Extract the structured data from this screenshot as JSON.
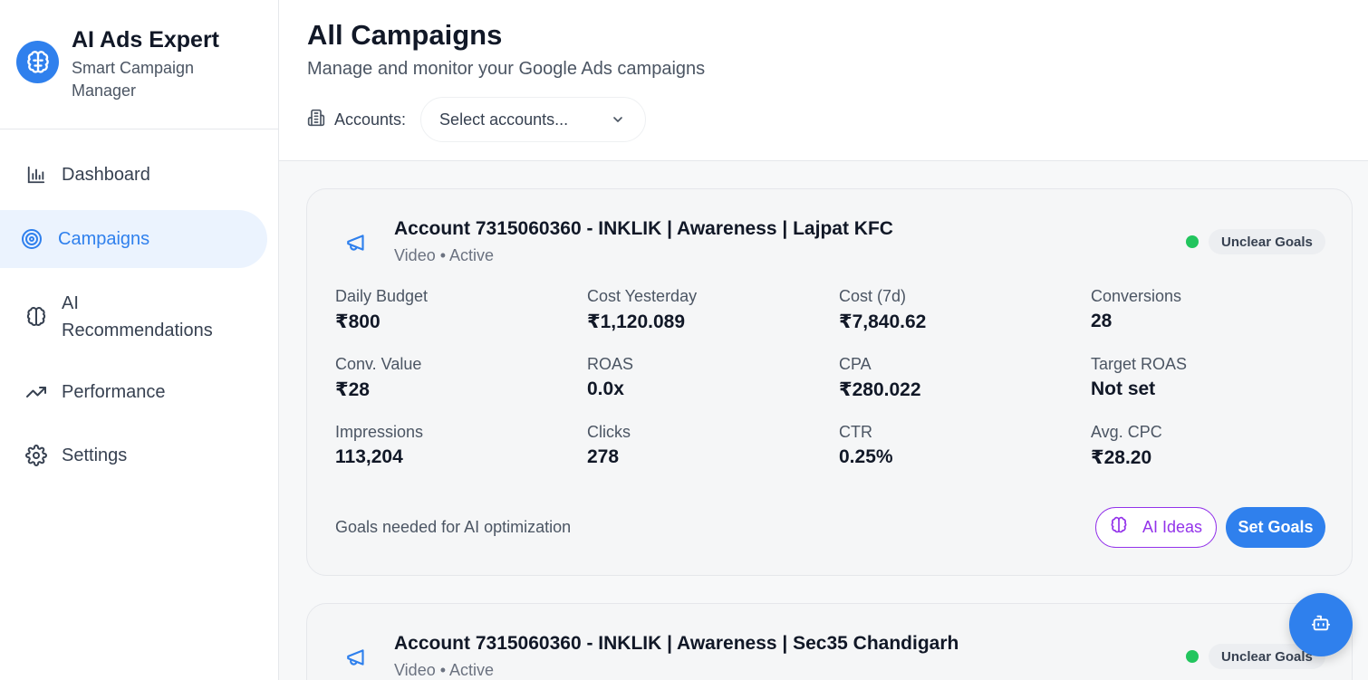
{
  "brand": {
    "title": "AI Ads Expert",
    "subtitle": "Smart Campaign Manager"
  },
  "nav": [
    {
      "label": "Dashboard",
      "icon": "bar-chart-icon",
      "active": false
    },
    {
      "label": "Campaigns",
      "icon": "target-icon",
      "active": true
    },
    {
      "label": "AI Recommendations",
      "icon": "brain-icon",
      "active": false
    },
    {
      "label": "Performance",
      "icon": "trending-up-icon",
      "active": false
    },
    {
      "label": "Settings",
      "icon": "gear-icon",
      "active": false
    }
  ],
  "header": {
    "title": "All Campaigns",
    "subtitle": "Manage and monitor your Google Ads campaigns",
    "accounts_label": "Accounts:",
    "accounts_placeholder": "Select accounts..."
  },
  "colors": {
    "accent": "#2f80ed",
    "status_active": "#22c55e",
    "ai_purple": "#9333ea"
  },
  "campaigns": [
    {
      "title": "Account 7315060360 - INKLIK | Awareness | Lajpat KFC",
      "subtitle": "Video • Active",
      "goal_badge": "Unclear Goals",
      "metrics": [
        {
          "label": "Daily Budget",
          "value": "₹800"
        },
        {
          "label": "Cost Yesterday",
          "value": "₹1,120.089"
        },
        {
          "label": "Cost (7d)",
          "value": "₹7,840.62"
        },
        {
          "label": "Conversions",
          "value": "28"
        },
        {
          "label": "Conv. Value",
          "value": "₹28"
        },
        {
          "label": "ROAS",
          "value": "0.0x"
        },
        {
          "label": "CPA",
          "value": "₹280.022"
        },
        {
          "label": "Target ROAS",
          "value": "Not set"
        },
        {
          "label": "Impressions",
          "value": "113,204"
        },
        {
          "label": "Clicks",
          "value": "278"
        },
        {
          "label": "CTR",
          "value": "0.25%"
        },
        {
          "label": "Avg. CPC",
          "value": "₹28.20"
        }
      ],
      "goals_note": "Goals needed for AI optimization",
      "ai_ideas_label": "AI Ideas",
      "set_goals_label": "Set Goals"
    },
    {
      "title": "Account 7315060360 - INKLIK | Awareness | Sec35 Chandigarh",
      "subtitle": "Video • Active",
      "goal_badge": "Unclear Goals"
    }
  ]
}
